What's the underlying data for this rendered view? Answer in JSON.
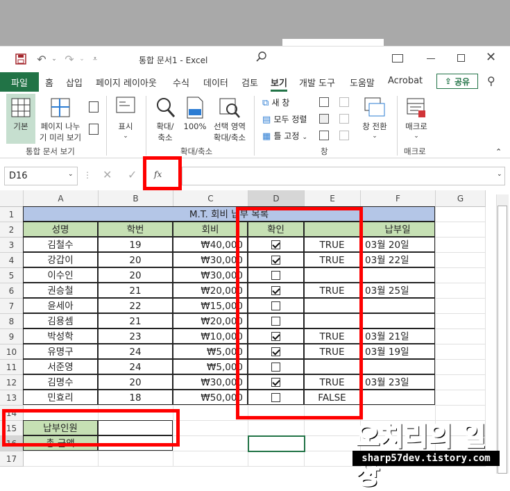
{
  "window": {
    "title": "통합 문서1  -  Excel"
  },
  "tabs": [
    "파일",
    "홈",
    "삽입",
    "페이지 레이아웃",
    "수식",
    "데이터",
    "검토",
    "보기",
    "개발 도구",
    "도움말",
    "Acrobat"
  ],
  "share_label": "공유",
  "ribbon": {
    "normal": "기본",
    "page_break": [
      "페이지 나누",
      "기 미리 보기"
    ],
    "group_views": "통합 문서 보기",
    "show": "표시",
    "zoom": [
      "확대/",
      "축소"
    ],
    "zoom100": "100%",
    "zoom_selection": [
      "선택 영역",
      "확대/축소"
    ],
    "group_zoom": "확대/축소",
    "new_window": "새 창",
    "arrange_all": "모두 정렬",
    "freeze": "틀 고정",
    "switch": [
      "창 전환"
    ],
    "group_window": "창",
    "macro": "매크로",
    "group_macro": "매크로"
  },
  "formula_bar": {
    "name_box": "D16",
    "fx": "fx"
  },
  "columns": [
    "A",
    "B",
    "C",
    "D",
    "E",
    "F",
    "G"
  ],
  "rows": [
    "1",
    "2",
    "3",
    "4",
    "5",
    "6",
    "7",
    "8",
    "9",
    "10",
    "11",
    "12",
    "13",
    "14",
    "15",
    "16",
    "17"
  ],
  "sheet": {
    "title": "M.T. 회비 납부 목록",
    "headers": [
      "성명",
      "학번",
      "회비",
      "확인",
      "",
      "납부일"
    ],
    "records": [
      {
        "name": "김철수",
        "id": "19",
        "fee": "₩40,000",
        "checked": true,
        "flag": "TRUE",
        "date": "03월 20일"
      },
      {
        "name": "강갑이",
        "id": "20",
        "fee": "₩30,000",
        "checked": true,
        "flag": "TRUE",
        "date": "03월 22일"
      },
      {
        "name": "이수인",
        "id": "20",
        "fee": "₩30,000",
        "checked": false,
        "flag": "",
        "date": ""
      },
      {
        "name": "권승철",
        "id": "21",
        "fee": "₩20,000",
        "checked": true,
        "flag": "TRUE",
        "date": "03월 25일"
      },
      {
        "name": "윤세아",
        "id": "22",
        "fee": "₩15,000",
        "checked": false,
        "flag": "",
        "date": ""
      },
      {
        "name": "김용셈",
        "id": "21",
        "fee": "₩20,000",
        "checked": false,
        "flag": "",
        "date": ""
      },
      {
        "name": "박성학",
        "id": "23",
        "fee": "₩10,000",
        "checked": true,
        "flag": "TRUE",
        "date": "03월 21일"
      },
      {
        "name": "유명구",
        "id": "24",
        "fee": "₩5,000",
        "checked": true,
        "flag": "TRUE",
        "date": "03월 19일"
      },
      {
        "name": "서준영",
        "id": "24",
        "fee": "₩5,000",
        "checked": false,
        "flag": "",
        "date": ""
      },
      {
        "name": "김명수",
        "id": "20",
        "fee": "₩30,000",
        "checked": true,
        "flag": "TRUE",
        "date": "03월 23일"
      },
      {
        "name": "민효리",
        "id": "18",
        "fee": "₩50,000",
        "checked": false,
        "flag": "FALSE",
        "date": ""
      }
    ],
    "summary": [
      "납부인원",
      "총 금액"
    ]
  },
  "watermark": {
    "title": "오치리의 일상",
    "url": "sharp57dev.tistory.com"
  },
  "colors": {
    "excel_green": "#217346",
    "header_green": "#c6e0b4",
    "title_blue": "#b4c6e7",
    "highlight_red": "#ff0000"
  }
}
